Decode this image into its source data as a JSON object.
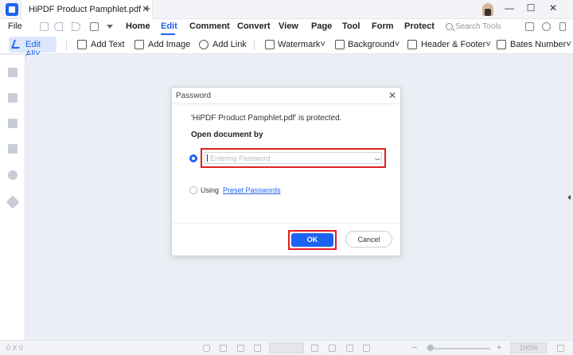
{
  "window": {
    "tab_title": "HiPDF Product Pamphlet.pdf",
    "tab_close": "✕",
    "new_tab": "+",
    "minimize": "—",
    "maximize": "☐",
    "close": "✕"
  },
  "menu": {
    "items": [
      "File",
      "Home",
      "Edit",
      "Comment",
      "Convert",
      "View",
      "Page",
      "Tool",
      "Form",
      "Protect"
    ],
    "active": "Edit",
    "search_placeholder": "Search Tools"
  },
  "toolbar": {
    "edit_all": "Edit All",
    "items": [
      "Add Text",
      "Add Image",
      "Add Link",
      "Watermark",
      "Background",
      "Header & Footer",
      "Bates Number"
    ],
    "icons": [
      "text-box-icon",
      "image-icon",
      "link-icon",
      "watermark-icon",
      "background-icon",
      "header-footer-icon",
      "bates-number-icon"
    ]
  },
  "sidebar": {
    "icons": [
      "bookmark-panel-icon",
      "bookmark-icon",
      "comment-icon",
      "attachment-icon",
      "search-panel-icon",
      "layers-icon"
    ]
  },
  "dialog": {
    "title": "Password",
    "close": "✕",
    "message": "'HiPDF Product Pamphlet.pdf' is protected.",
    "subtitle": "Open document by",
    "password_placeholder": "Entering Password",
    "option_password_selected": true,
    "using_label": "Using",
    "preset_link": "Preset Passwords",
    "ok_label": "OK",
    "cancel_label": "Cancel"
  },
  "status": {
    "dims": "0 X 0",
    "zoom": "100%",
    "zoom_minus": "−",
    "zoom_plus": "+"
  },
  "colors": {
    "accent": "#1d63f2",
    "highlight": "#e02020"
  }
}
